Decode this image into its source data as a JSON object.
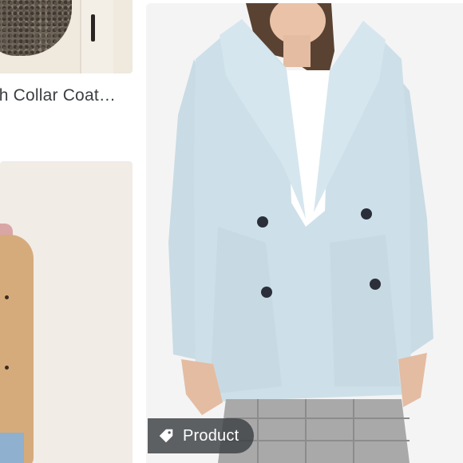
{
  "results": {
    "left_cards": [
      {
        "title": "ch Collar Coat…"
      }
    ],
    "main_card": {
      "badge_label": "Product",
      "badge_icon": "tag-icon"
    }
  },
  "colors": {
    "coat_blue": "#c9dbe4",
    "chip_bg": "#3c4043"
  }
}
